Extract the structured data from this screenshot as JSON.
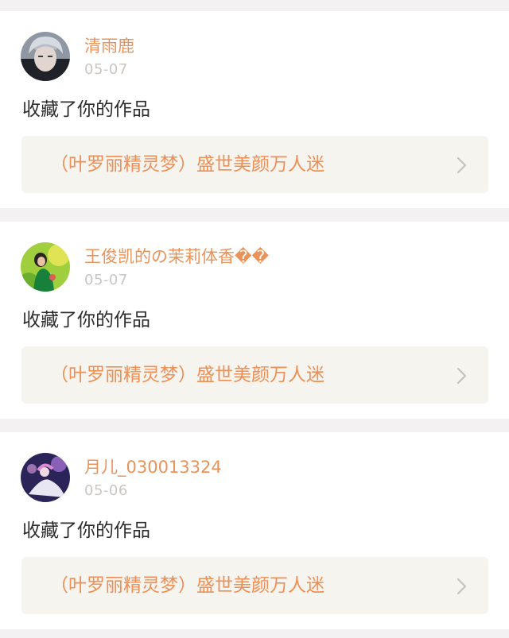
{
  "notifications": [
    {
      "user": "清雨鹿",
      "time": "05-07",
      "action": "收藏了你的作品",
      "work_title": "（叶罗丽精灵梦）盛世美颜万人迷"
    },
    {
      "user": "王俊凯的の茉莉体香��",
      "time": "05-07",
      "action": "收藏了你的作品",
      "work_title": "（叶罗丽精灵梦）盛世美颜万人迷"
    },
    {
      "user": "月儿_030013324",
      "time": "05-06",
      "action": "收藏了你的作品",
      "work_title": "（叶罗丽精灵梦）盛世美颜万人迷"
    }
  ],
  "icons": {
    "avatar": "avatar-icon",
    "chevron": "chevron-right-icon"
  },
  "colors": {
    "username": "#e9935a",
    "work_title": "#ee8f55",
    "timestamp": "#c9c6c4",
    "card_bg": "#ffffff",
    "page_bg": "#f3f1f1",
    "link_bg": "#f5f4ef"
  }
}
